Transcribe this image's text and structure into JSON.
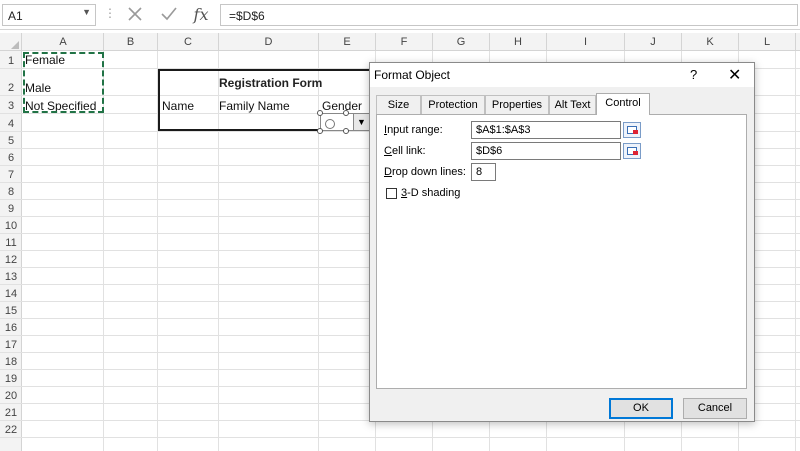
{
  "formula_bar": {
    "name_box": "A1",
    "separator": "⋮",
    "cancel_icon": "✕",
    "enter_icon": "✓",
    "fx_label": "fx",
    "formula": "=$D$6"
  },
  "columns": [
    "A",
    "B",
    "C",
    "D",
    "E",
    "F",
    "G",
    "H",
    "I",
    "J",
    "K",
    "L"
  ],
  "rows": [
    "1",
    "2",
    "3",
    "4",
    "5",
    "6",
    "7",
    "8",
    "9",
    "10",
    "11",
    "12",
    "13",
    "14",
    "15",
    "16",
    "17",
    "18",
    "19",
    "20",
    "21",
    "22"
  ],
  "cells": {
    "A1": "Female",
    "A2": "Male",
    "A3": "Not Specified",
    "D2": "Registration Form",
    "C3": "Name",
    "D3": "Family Name",
    "E3": "Gender"
  },
  "dropdown": {
    "arrow": "▼"
  },
  "dialog": {
    "title": "Format Object",
    "help": "?",
    "close": "✕",
    "tabs": [
      "Size",
      "Protection",
      "Properties",
      "Alt Text",
      "Control"
    ],
    "active_tab": "Control",
    "fields": {
      "input_range": {
        "label_first": "I",
        "label_rest": "nput range:",
        "value": "$A$1:$A$3"
      },
      "cell_link": {
        "label_first": "C",
        "label_rest": "ell link:",
        "value": "$D$6"
      },
      "drop_down_lines": {
        "label_first": "D",
        "label_rest": "rop down lines:",
        "value": "8"
      }
    },
    "shading": {
      "label_first": "3",
      "label_rest": "-D shading",
      "checked": false
    },
    "ok_label": "OK",
    "cancel_label": "Cancel"
  }
}
